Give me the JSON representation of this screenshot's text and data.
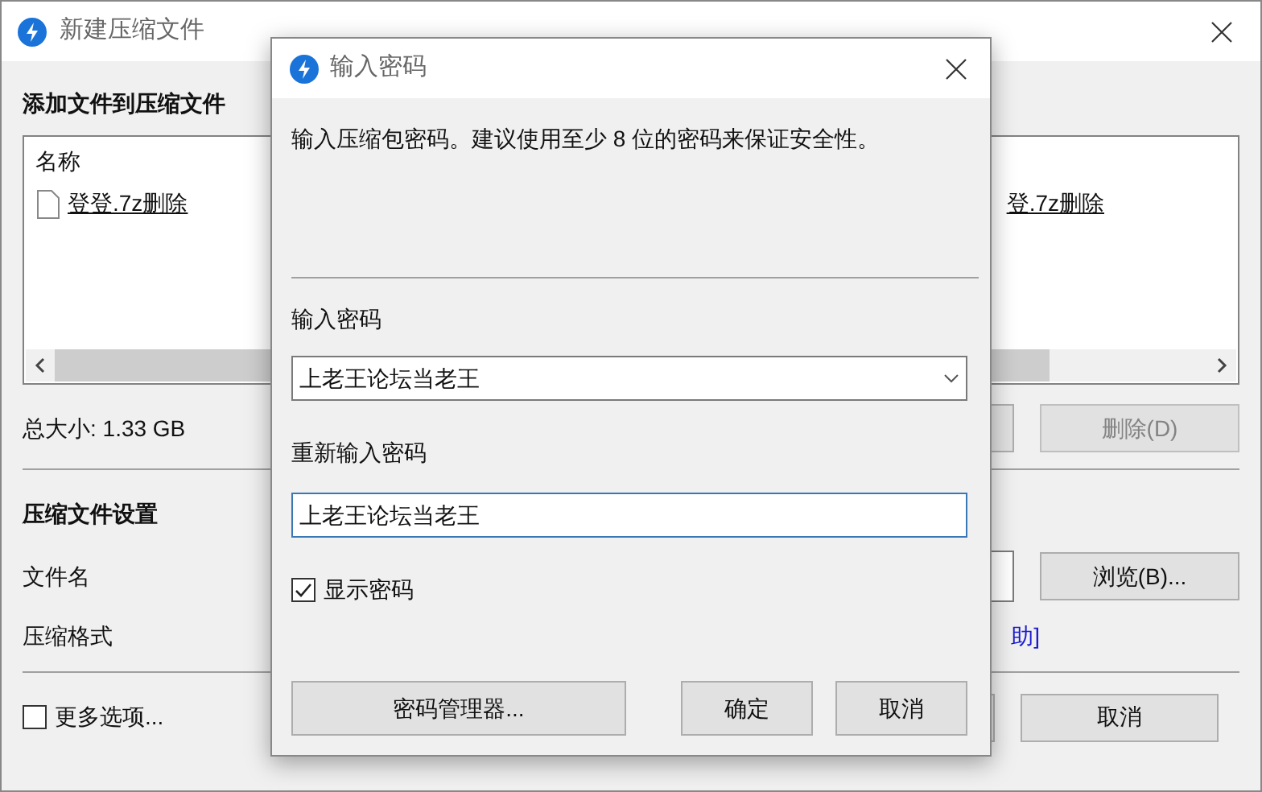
{
  "main_window": {
    "title": "新建压缩文件",
    "add_section": {
      "heading": "添加文件到压缩文件"
    },
    "file_list": {
      "column_header": "名称",
      "file_name": "登登.7z删除",
      "file_name_right": "登.7z删除"
    },
    "total_size": "总大小: 1.33 GB",
    "delete_button": {
      "label": "删除(D)",
      "disabled": true
    },
    "settings_section": {
      "heading": "压缩文件设置"
    },
    "file_name_label": "文件名",
    "browse_button": {
      "label": "浏览(B)..."
    },
    "format_label": "压缩格式",
    "help_link": "助]",
    "more_options": {
      "label": "更多选项...",
      "checked": false
    },
    "cancel_button": {
      "label": "取消"
    }
  },
  "password_dialog": {
    "title": "输入密码",
    "description": "输入压缩包密码。建议使用至少 8 位的密码来保证安全性。",
    "password_label": "输入密码",
    "password_value": "上老王论坛当老王",
    "reenter_label": "重新输入密码",
    "reenter_value": "上老王论坛当老王",
    "reenter_focused": true,
    "show_password": {
      "label": "显示密码",
      "checked": true
    },
    "buttons": [
      {
        "label": "密码管理器...",
        "kind": "wide"
      },
      {
        "label": "确定",
        "kind": "normal"
      },
      {
        "label": "取消",
        "kind": "normal"
      }
    ]
  }
}
